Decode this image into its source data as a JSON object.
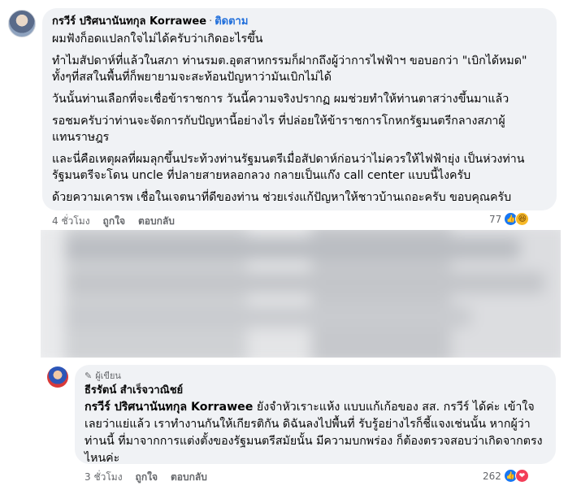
{
  "comment1": {
    "author": "กรวีร์ ปริศนานันทกุล Korrawee",
    "follow_label": "ติดตาม",
    "separator": "·",
    "paragraphs": [
      "ผมฟังก็อดแปลกใจไม่ได้ครับว่าเกิดอะไรขึ้น",
      "ทำไมสัปดาห์ที่แล้วในสภา ท่านรมต.อุตสาหกรรมก็ฝากถึงผู้ว่าการไฟฟ้าฯ ขอบอกว่า \"เบิกได้หมด\"\nทั้งๆที่สสในพื้นที่ก็พยายามจะสะท้อนปัญหาว่ามันเบิกไม่ได้",
      "วันนั้นท่านเลือกที่จะเชื่อข้าราชการ วันนี้ความจริงปรากฏ ผมช่วยทำให้ท่านตาสว่างขึ้นมาแล้ว",
      "รอชมครับว่าท่านจะจัดการกับปัญหานี้อย่างไร ที่ปล่อยให้ข้าราชการโกหกรัฐมนตรีกลางสภาผู้\nแทนราษฎร",
      "และนี่คือเหตุผลที่ผมลุกขึ้นประท้วงท่านรัฐมนตรีเมื่อสัปดาห์ก่อนว่าไม่ควรให้ไฟฟ้ายุ่ง เป็นห่วงท่าน\nรัฐมนตรีจะโดน uncle ที่ปลายสายหลอกลวง กลายเป็นแก๊ง call center แบบนี้ไงครับ",
      "ด้วยความเคารพ เชื่อในเจตนาที่ดีของท่าน ช่วยเร่งแก้ปัญหาให้ชาวบ้านเถอะครับ ขอบคุณครับ"
    ],
    "time": "4 ชั่วโมง",
    "like_label": "ถูกใจ",
    "reply_label": "ตอบกลับ",
    "reaction_count": "77"
  },
  "comment2": {
    "badge": "ผู้เขียน",
    "author": "ธีรรัตน์ สำเร็จวาณิชย์",
    "mention": "กรวีร์ ปริศนานันทกุล Korrawee",
    "text": " ยังจำหัวเราะแห้ง แบบแก้เก้อของ สส. กรวีร์ ได้ค่ะ เข้าใจเลยว่าแย่แล้ว เราทำงานกันให้เกียรติกัน ดิฉันลงไปพื้นที่ รับรู้อย่างไรก็ชี้แจงเช่นนั้น หากผู้ว่าท่านนี้ ที่มาจากการแต่งตั้งของรัฐมนตรีสมัยนั้น มีความบกพร่อง ก็ต้องตรวจสอบว่าเกิดจากตรงไหนค่ะ",
    "time": "3 ชั่วโมง",
    "like_label": "ถูกใจ",
    "reply_label": "ตอบกลับ",
    "reaction_count": "262"
  },
  "icons": {
    "like": "like-reaction-icon",
    "haha": "haha-reaction-icon",
    "love": "love-reaction-icon",
    "pen": "pen-icon"
  },
  "colors": {
    "bubble": "#f0f2f5",
    "follow": "#216fdb",
    "like": "#1877f2",
    "love": "#f33e58",
    "haha": "#f7b928"
  }
}
